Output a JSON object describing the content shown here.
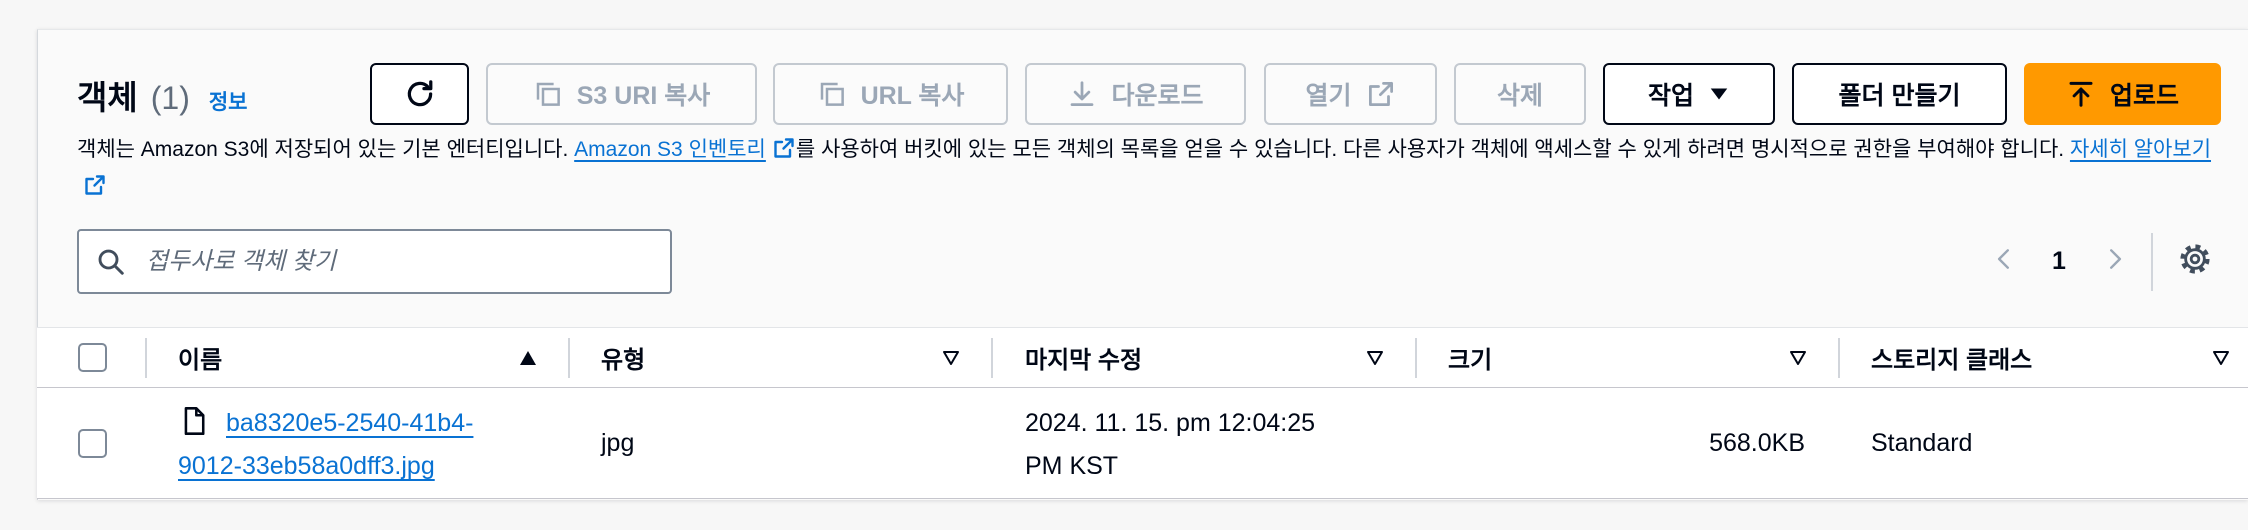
{
  "header": {
    "title": "객체",
    "count": "(1)",
    "info_link": "정보"
  },
  "toolbar": {
    "refresh": {
      "icon": "refresh-icon",
      "enabled": true
    },
    "copy_s3_uri": {
      "label": "S3 URI 복사",
      "icon": "copy-icon",
      "enabled": false
    },
    "copy_url": {
      "label": "URL 복사",
      "icon": "copy-icon",
      "enabled": false
    },
    "download": {
      "label": "다운로드",
      "icon": "download-icon",
      "enabled": false
    },
    "open": {
      "label": "열기",
      "icon": "external-link-icon",
      "enabled": false
    },
    "delete": {
      "label": "삭제",
      "enabled": false
    },
    "actions": {
      "label": "작업",
      "icon": "caret-down-icon",
      "enabled": true
    },
    "create_folder": {
      "label": "폴더 만들기",
      "enabled": true
    },
    "upload": {
      "label": "업로드",
      "icon": "upload-icon",
      "enabled": true
    }
  },
  "description": {
    "text_1": "객체는 Amazon S3에 저장되어 있는 기본 엔터티입니다. ",
    "inventory_link": "Amazon S3 인벤토리",
    "text_2": "를 사용하여 버킷에 있는 모든 객체의 목록을 얻을 수 있습니다. 다른 사용자가 객체에 액세스할 수 있게 하려면 명시적으로 권한을 부여해야 합니다. ",
    "learn_more_link": "자세히 알아보기"
  },
  "search": {
    "placeholder": "접두사로 객체 찾기"
  },
  "pagination": {
    "current_page": "1",
    "prev_enabled": false,
    "next_enabled": false
  },
  "table": {
    "columns": [
      {
        "label": "이름",
        "sorted_ascending": true
      },
      {
        "label": "유형",
        "sorted_ascending": false
      },
      {
        "label": "마지막 수정",
        "sorted_ascending": false
      },
      {
        "label": "크기",
        "sorted_ascending": false
      },
      {
        "label": "스토리지 클래스",
        "sorted_ascending": false
      }
    ],
    "rows": [
      {
        "selected": false,
        "name_lines": [
          "ba8320e5-2540-41b4-",
          "9012-33eb58a0dff3.jpg"
        ],
        "type": "jpg",
        "last_modified": "2024. 11. 15. pm 12:04:25 PM KST",
        "size": "568.0KB",
        "storage_class": "Standard"
      }
    ]
  },
  "colors": {
    "link": "#0972d3",
    "primary_button": "#ff9900",
    "text": "#000716",
    "secondary_text": "#5f6b7a",
    "disabled_text": "#9ba7b6"
  }
}
